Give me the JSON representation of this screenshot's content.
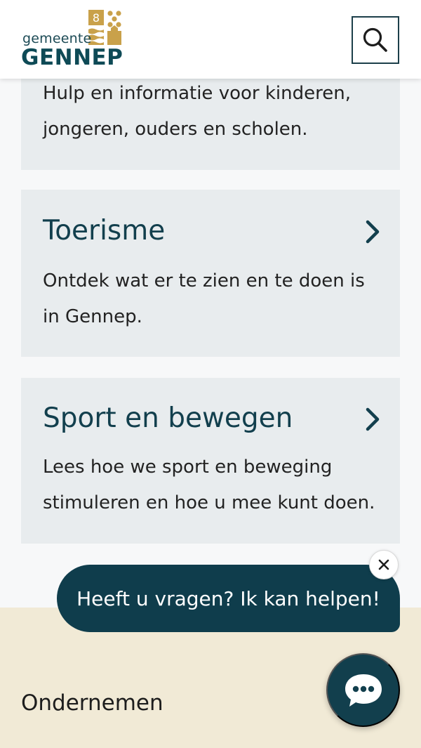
{
  "header": {
    "logo_small": "gemeente",
    "logo_big": "GENNEP",
    "search_icon": "search-icon"
  },
  "cards": [
    {
      "title": "",
      "description": "Hulp en informatie voor kinderen, jongeren, ouders en scholen."
    },
    {
      "title": "Toerisme",
      "description": "Ontdek wat er te zien en te doen is in Gennep.",
      "icon": "chevron-right-icon"
    },
    {
      "title": "Sport en bewegen",
      "description": "Lees hoe we sport en beweging stimuleren en hoe u mee kunt doen.",
      "icon": "chevron-right-icon"
    }
  ],
  "chat": {
    "bubble_text": "Heeft u vragen? Ik kan helpen!",
    "close_icon": "close-icon",
    "launcher_icon": "chat-icon"
  },
  "footer": {
    "heading": "Ondernemen"
  },
  "colors": {
    "brand_dark": "#0f3d4c",
    "brand_gold": "#c9a14a",
    "card_bg": "#e8ecee",
    "footer_bg": "#f1ead6"
  }
}
